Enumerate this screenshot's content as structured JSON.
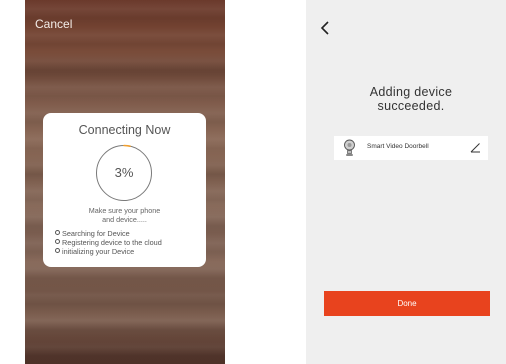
{
  "left_screen": {
    "cancel_label": "Cancel",
    "card": {
      "title": "Connecting Now",
      "progress_text": "3%",
      "progress_fraction": 0.03,
      "hint_line1": "Make sure your phone",
      "hint_line2": "and device.....",
      "steps": [
        "Searching for Device",
        "Registering device to the cloud",
        "initializing your Device"
      ]
    }
  },
  "right_screen": {
    "back_icon": "chevron-left-icon",
    "title_line1": "Adding device",
    "title_line2": "succeeded.",
    "device": {
      "icon": "doorbell-icon",
      "name": "Smart Video Doorbell",
      "edit_icon": "pencil-icon"
    },
    "done_label": "Done"
  },
  "colors": {
    "accent": "#e8431e",
    "progress_arc": "#f0a030",
    "card_text": "#555555",
    "right_background": "#efefef"
  }
}
